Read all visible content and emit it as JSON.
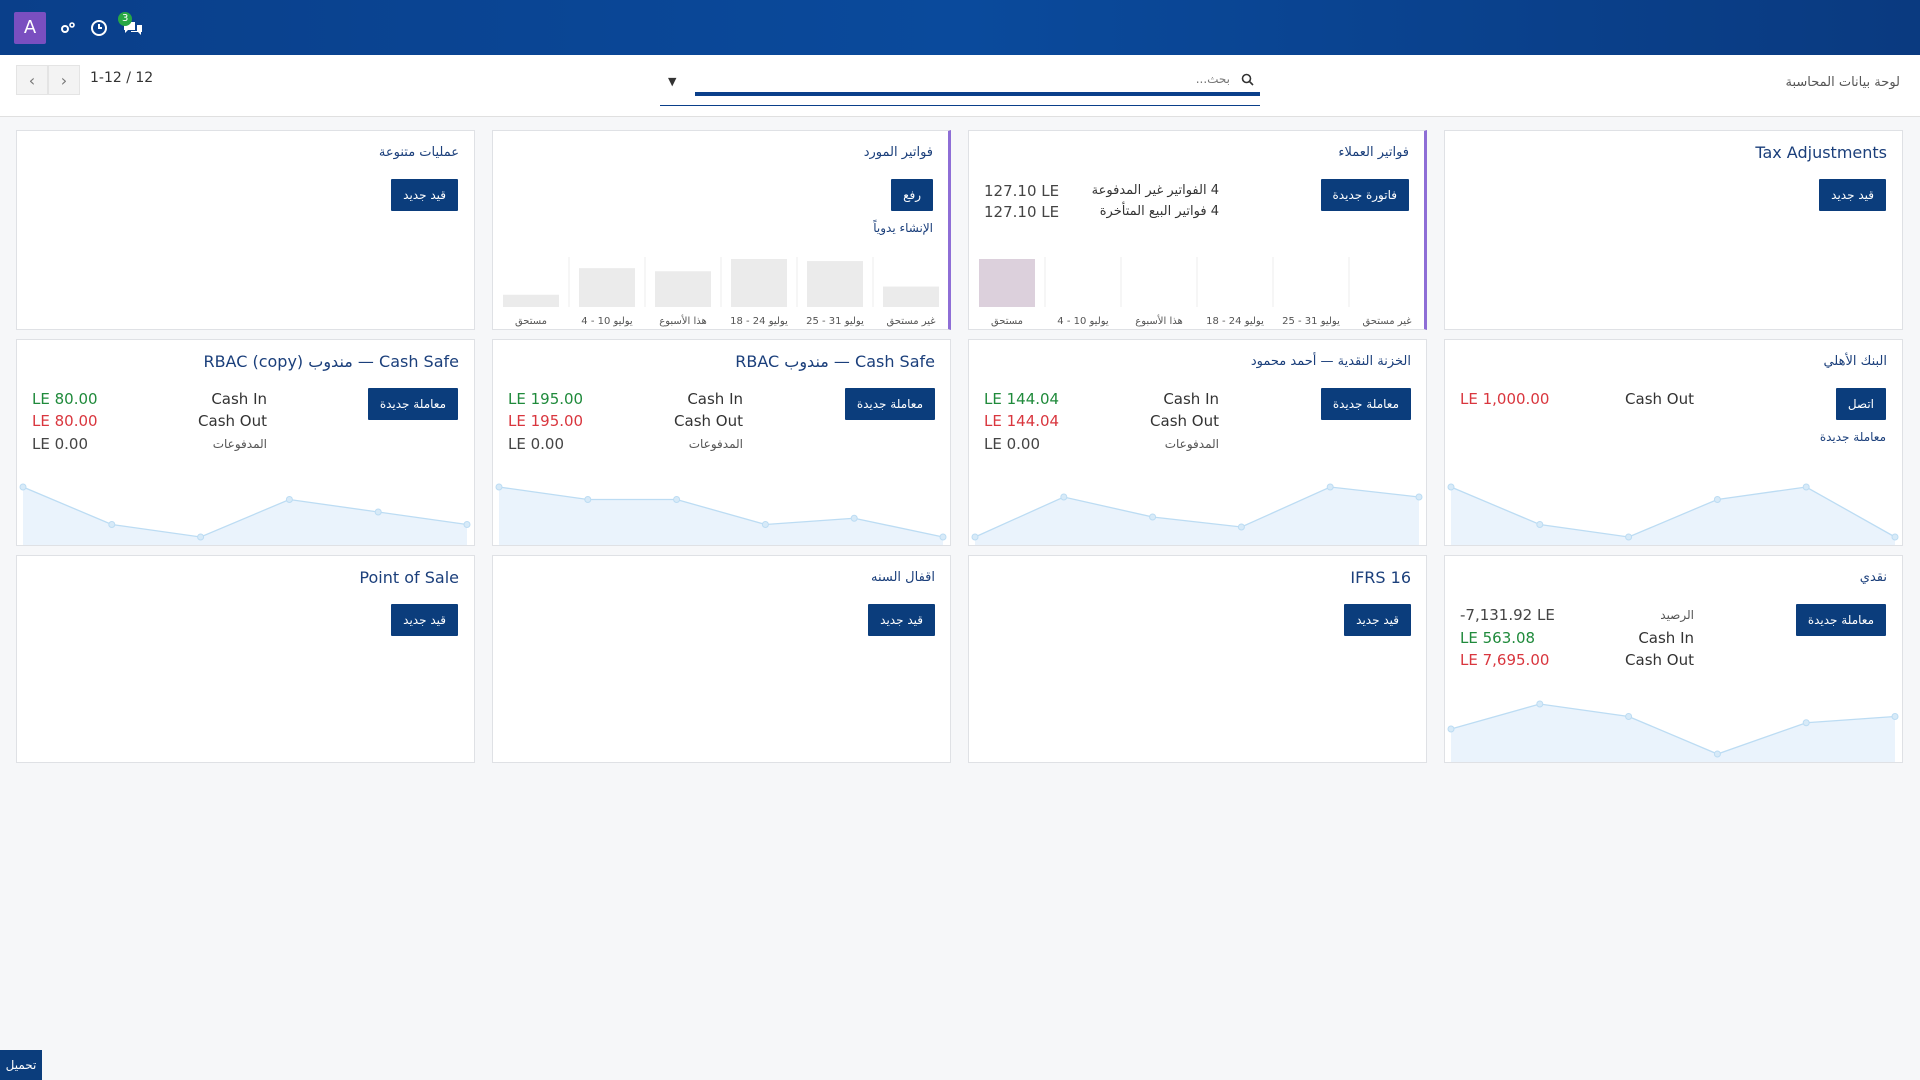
{
  "navbar": {
    "avatar_letter": "A",
    "chat_badge": "3"
  },
  "control": {
    "breadcrumb": "لوحة بيانات المحاسبة",
    "search_placeholder": "بحث...",
    "pager_value": "1-12 / 12"
  },
  "cards": {
    "tax_adjustments": {
      "title": "Tax Adjustments",
      "button": "قيد جديد"
    },
    "customer_invoices": {
      "title": "فواتير العملاء",
      "button": "فاتورة جديدة",
      "unpaid_label": "4 الفواتير غير المدفوعة",
      "unpaid_value": "127.10 LE",
      "late_label": "4 فواتير البيع المتأخرة",
      "late_value": "127.10 LE",
      "x_labels": [
        "غير مستحق",
        "25 - 31 يوليو",
        "18 - 24 يوليو",
        "هذا الأسبوع",
        "4 - 10 يوليو",
        "مستحق"
      ],
      "bar_values": [
        0,
        0,
        0,
        0,
        0,
        127.1
      ]
    },
    "vendor_bills": {
      "title": "فواتير المورد",
      "button": "رفع",
      "manual_link": "الإنشاء يدوياً",
      "x_labels": [
        "غير مستحق",
        "25 - 31 يوليو",
        "18 - 24 يوليو",
        "هذا الأسبوع",
        "4 - 10 يوليو",
        "مستحق"
      ],
      "bar_values": [
        2,
        4.5,
        4.7,
        3.5,
        3.8,
        1.2
      ]
    },
    "misc_ops": {
      "title": "عمليات متنوعة",
      "button": "قيد جديد"
    },
    "ahly_bank": {
      "title": "البنك الأهلي",
      "button": "اتصل",
      "new_tx_link": "معاملة جديدة",
      "cash_out_label": "Cash Out",
      "cash_out_value": "LE 1,000.00",
      "spark": [
        6,
        3,
        2,
        5,
        6,
        2
      ]
    },
    "treasury_ahmed": {
      "title": "الخزنة النقدية — أحمد محمود",
      "button": "معاملة جديدة",
      "cash_in_label": "Cash In",
      "cash_in_value": "LE 144.04",
      "cash_out_label": "Cash Out",
      "cash_out_value": "LE 144.04",
      "payments_label": "المدفوعات",
      "payments_value": "LE 0.00",
      "spark": [
        1,
        5,
        3,
        2,
        6,
        5
      ]
    },
    "cash_safe_rbac": {
      "title": "Cash Safe — مندوب RBAC",
      "button": "معاملة جديدة",
      "cash_in_label": "Cash In",
      "cash_in_value": "LE 195.00",
      "cash_out_label": "Cash Out",
      "cash_out_value": "LE 195.00",
      "payments_label": "المدفوعات",
      "payments_value": "LE 0.00",
      "spark": [
        5,
        4,
        4,
        2,
        2.5,
        1
      ]
    },
    "cash_safe_rbac_copy": {
      "title": "Cash Safe — مندوب RBAC (copy)",
      "button": "معاملة جديدة",
      "cash_in_label": "Cash In",
      "cash_in_value": "LE 80.00",
      "cash_out_label": "Cash Out",
      "cash_out_value": "LE 80.00",
      "payments_label": "المدفوعات",
      "payments_value": "LE 0.00",
      "spark": [
        5,
        2,
        1,
        4,
        3,
        2
      ]
    },
    "cash": {
      "title": "نقدي",
      "button": "معاملة جديدة",
      "balance_label": "الرصيد",
      "balance_value": "-7,131.92 LE",
      "cash_in_label": "Cash In",
      "cash_in_value": "LE 563.08",
      "cash_out_label": "Cash Out",
      "cash_out_value": "LE 7,695.00",
      "spark": [
        3,
        5,
        4,
        1,
        3.5,
        4
      ]
    },
    "ifrs16": {
      "title": "IFRS 16",
      "button": "قيد جديد"
    },
    "year_close": {
      "title": "اقفال السنه",
      "button": "قيد جديد"
    },
    "pos": {
      "title": "Point of Sale",
      "button": "قيد جديد"
    }
  },
  "footer": {
    "load_label": "تحميل"
  },
  "colors": {
    "navbar": "#0a3f8a",
    "button": "#0b3d7c",
    "accent_purple": "#8e6ed6",
    "positive": "#1f8a3b",
    "negative": "#d9363e"
  }
}
